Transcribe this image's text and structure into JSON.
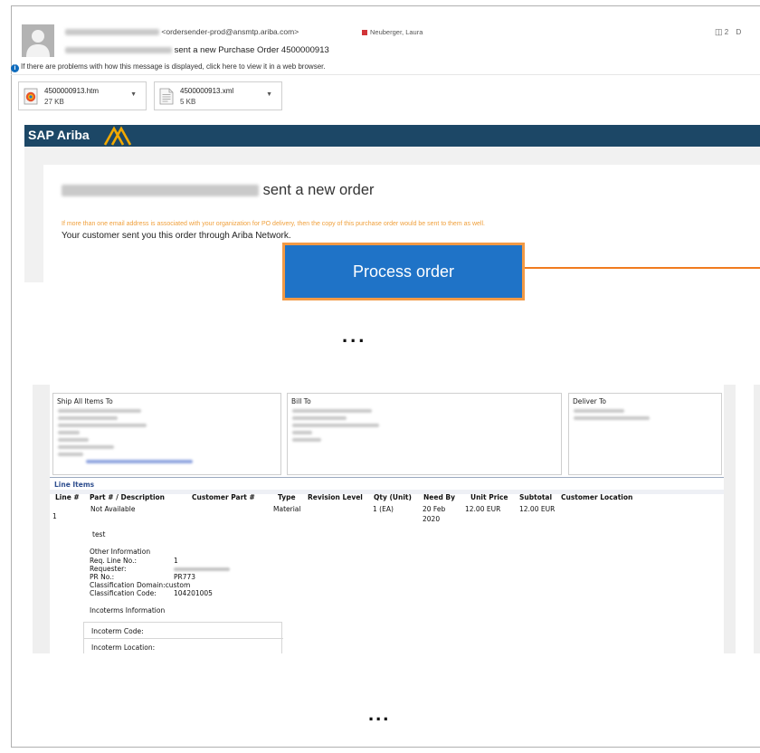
{
  "email": {
    "sender_address": "<ordersender-prod@ansmtp.ariba.com>",
    "recipient_tag": "Neuberger, Laura",
    "subject_suffix": "sent a new Purchase Order 4500000913",
    "people_count": "2",
    "people_trailing": "D",
    "info_bar": "If there are problems with how this message is displayed, click here to view it in a web browser.",
    "attachments": [
      {
        "name": "4500000913.htm",
        "size": "27 KB"
      },
      {
        "name": "4500000913.xml",
        "size": "5 KB"
      }
    ]
  },
  "ariba": {
    "logo": "SAP Ariba",
    "headline_suffix": "sent a new order",
    "orange_note": "If more than one email address is associated with your organization for PO delivery, then the copy of this purchase order would be sent to them as well.",
    "customer_line": "Your customer sent you this order through Ariba Network.",
    "process_button": "Process order"
  },
  "ellipsis": "...",
  "po": {
    "addresses": [
      {
        "title": "Ship All Items To"
      },
      {
        "title": "Bill To"
      },
      {
        "title": "Deliver To"
      }
    ],
    "section_title": "Line Items",
    "columns": [
      "Line #",
      "Part # / Description",
      "Customer Part #",
      "Type",
      "Revision Level",
      "Qty (Unit)",
      "Need By",
      "Unit Price",
      "Subtotal",
      "Customer Location"
    ],
    "row": {
      "line": "1",
      "part": "Not Available",
      "type": "Material",
      "qty": "1 (EA)",
      "need_by_1": "20 Feb",
      "need_by_2": "2020",
      "unit_price": "12.00 EUR",
      "subtotal": "12.00 EUR",
      "description": "test"
    },
    "other_info": {
      "title": "Other Information",
      "req_line_label": "Req. Line No.:",
      "req_line_value": "1",
      "requester_label": "Requester:",
      "pr_label": "PR No.:",
      "pr_value": "PR773",
      "class_domain_label": "Classification Domain:",
      "class_domain_value": "custom",
      "class_code_label": "Classification Code:",
      "class_code_value": "104201005"
    },
    "incoterms": {
      "title": "Incoterms Information",
      "code_label": "Incoterm Code:",
      "location_label": "Incoterm Location:"
    }
  },
  "colors": {
    "ariba_navy": "#1c4766",
    "button_blue": "#1f73c7",
    "button_border": "#f39a45",
    "connector_orange": "#f07b1f",
    "note_orange": "#f0a03c",
    "section_blue": "#2f4f8f"
  }
}
